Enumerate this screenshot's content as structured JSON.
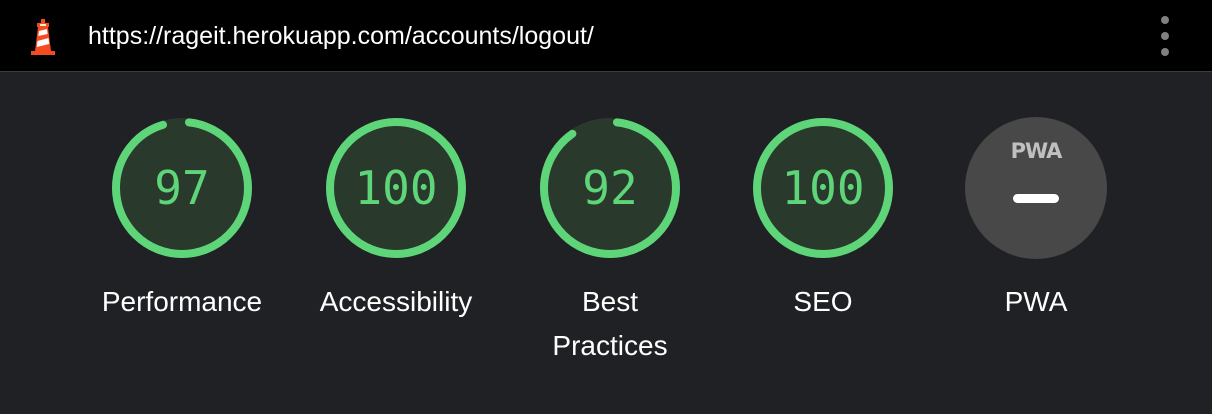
{
  "header": {
    "url": "https://rageit.herokuapp.com/accounts/logout/",
    "logo_icon": "lighthouse-logo-icon",
    "menu_icon": "vertical-dots-menu-icon"
  },
  "colors": {
    "pass": "#5fd57a",
    "pass_track": "#293a2c",
    "background": "#202124",
    "pwa_circle": "#484848"
  },
  "gauges": [
    {
      "score": "97",
      "label": "Performance",
      "fraction": 0.97
    },
    {
      "score": "100",
      "label": "Accessibility",
      "fraction": 1.0
    },
    {
      "score": "92",
      "label": "Best\nPractices",
      "fraction": 0.92
    },
    {
      "score": "100",
      "label": "SEO",
      "fraction": 1.0
    }
  ],
  "pwa": {
    "badge": "PWA",
    "label": "PWA",
    "status": "not applicable"
  }
}
